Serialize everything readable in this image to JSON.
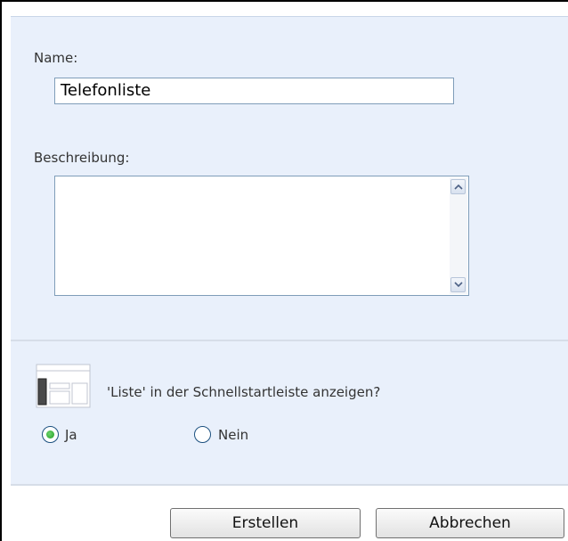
{
  "form": {
    "name_label": "Name:",
    "name_value": "Telefonliste",
    "description_label": "Beschreibung:",
    "description_value": ""
  },
  "quick_launch": {
    "icon": "quick-launch-list-icon",
    "question": "'Liste' in der Schnellstartleiste anzeigen?",
    "options": [
      {
        "label": "Ja",
        "selected": true
      },
      {
        "label": "Nein",
        "selected": false
      }
    ]
  },
  "buttons": {
    "create_label": "Erstellen",
    "cancel_label": "Abbrechen"
  },
  "colors": {
    "panel_background": "#e9f0fb",
    "input_border": "#7f9db9",
    "radio_selected": "#1f9e1f"
  }
}
